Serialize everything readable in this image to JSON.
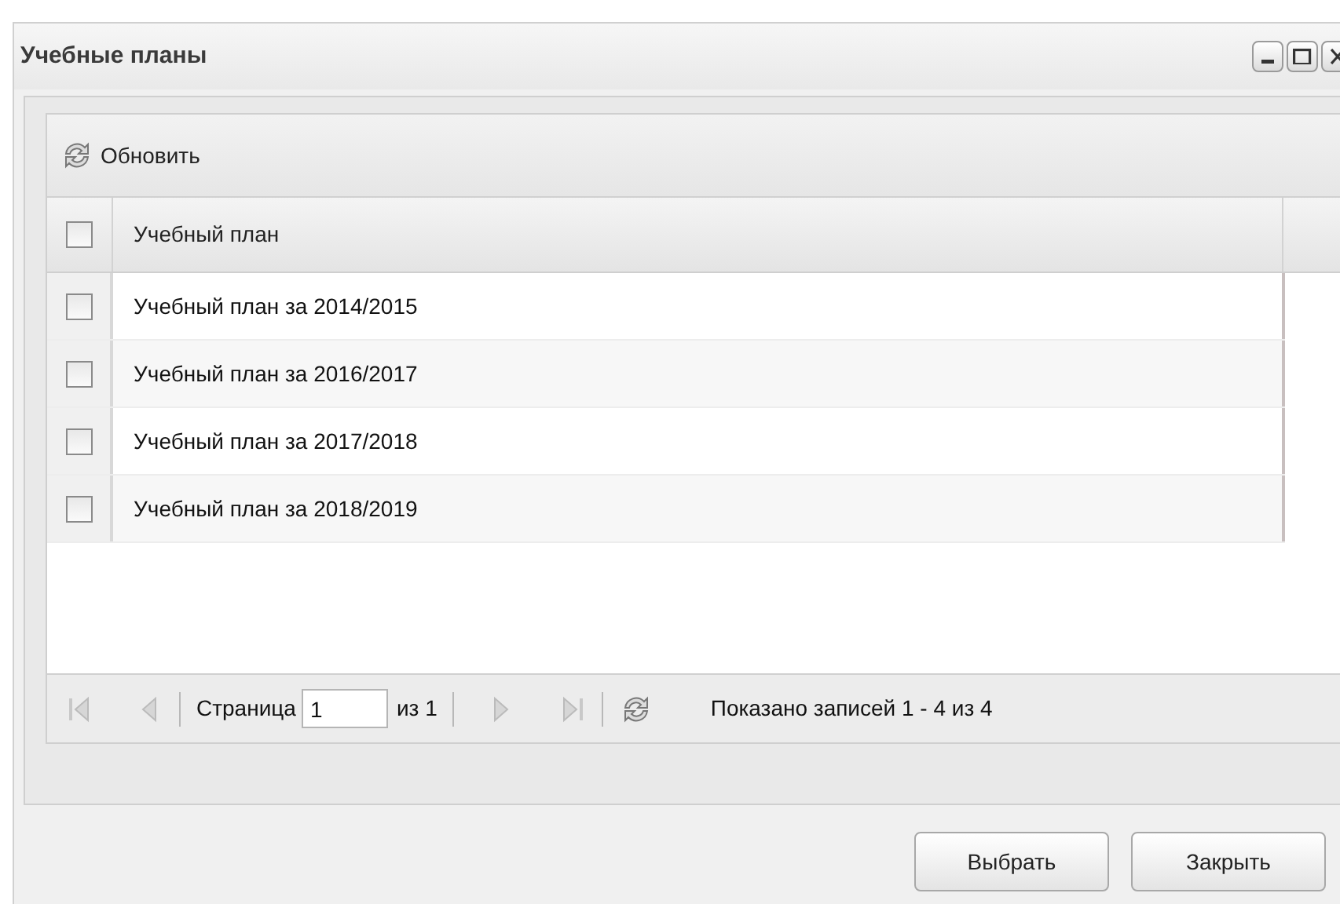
{
  "window": {
    "title": "Учебные планы"
  },
  "toolbar": {
    "refresh_label": "Обновить"
  },
  "table": {
    "header": {
      "label": "Учебный план",
      "checked": false
    },
    "rows": [
      {
        "label": "Учебный план за 2014/2015",
        "checked": false
      },
      {
        "label": "Учебный план за 2016/2017",
        "checked": false
      },
      {
        "label": "Учебный план за 2017/2018",
        "checked": false
      },
      {
        "label": "Учебный план за 2018/2019",
        "checked": false
      }
    ]
  },
  "pager": {
    "page_label": "Страница",
    "page_value": "1",
    "of_label": "из 1",
    "summary": "Показано записей 1 - 4 из 4"
  },
  "buttons": [
    "Выбрать",
    "Закрыть"
  ]
}
